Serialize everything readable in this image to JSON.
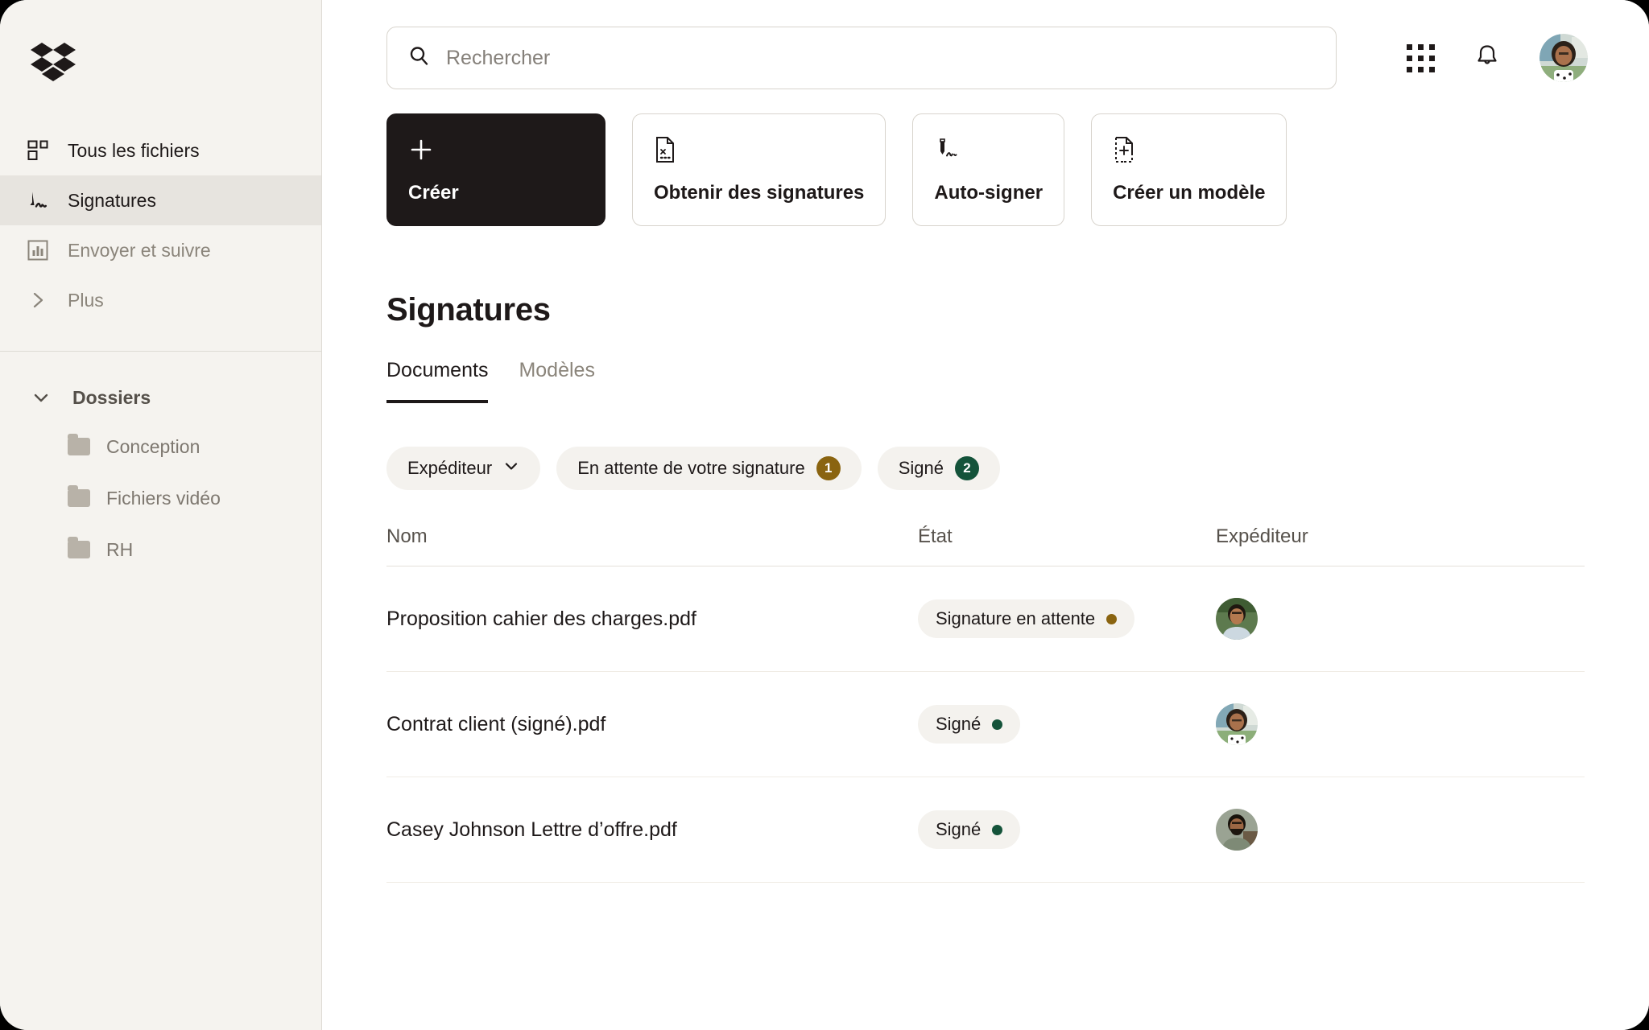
{
  "colors": {
    "sidebar_bg": "#f5f3ef",
    "sidebar_active_bg": "#e7e4df",
    "main_bg": "#ffffff",
    "text_primary": "#1e1919",
    "text_muted": "#8b857b",
    "chip_bg": "#f4f2ee",
    "badge_amber": "#8a6410",
    "badge_green": "#14533a",
    "dot_amber": "#8a6410",
    "dot_green": "#14533a",
    "border": "#d8d4cd"
  },
  "sidebar": {
    "logo_name": "dropbox-logo",
    "items": [
      {
        "label": "Tous les fichiers",
        "icon": "all-files-icon",
        "active": false,
        "strong": true
      },
      {
        "label": "Signatures",
        "icon": "signature-pen-icon",
        "active": true,
        "strong": true
      },
      {
        "label": "Envoyer et suivre",
        "icon": "send-track-chart-icon",
        "active": false,
        "strong": false
      },
      {
        "label": "Plus",
        "icon": "chevron-right-icon",
        "active": false,
        "strong": false
      }
    ],
    "folders_header": {
      "label": "Dossiers",
      "icon": "chevron-down-icon",
      "expanded": true
    },
    "folders": [
      {
        "label": "Conception"
      },
      {
        "label": "Fichiers vidéo"
      },
      {
        "label": "RH"
      }
    ]
  },
  "topbar": {
    "search": {
      "placeholder": "Rechercher",
      "value": "",
      "icon": "search-icon"
    },
    "apps_icon": "grid-apps-icon",
    "notifications_icon": "bell-icon",
    "avatar": "user-avatar"
  },
  "actions": [
    {
      "label": "Créer",
      "icon": "plus-icon",
      "primary": true
    },
    {
      "label": "Obtenir des signatures",
      "icon": "document-signature-request-icon",
      "primary": false
    },
    {
      "label": "Auto-signer",
      "icon": "pen-self-sign-icon",
      "primary": false
    },
    {
      "label": "Créer un modèle",
      "icon": "document-add-template-icon",
      "primary": false
    }
  ],
  "page": {
    "title": "Signatures"
  },
  "tabs": [
    {
      "label": "Documents",
      "active": true
    },
    {
      "label": "Modèles",
      "active": false
    }
  ],
  "filters": [
    {
      "label": "Expéditeur",
      "icon": "chevron-down-icon",
      "badge": null,
      "badge_color": null
    },
    {
      "label": "En attente de votre signature",
      "icon": null,
      "badge": "1",
      "badge_color": "#8a6410"
    },
    {
      "label": "Signé",
      "icon": null,
      "badge": "2",
      "badge_color": "#14533a"
    }
  ],
  "table": {
    "columns": [
      "Nom",
      "État",
      "Expéditeur"
    ],
    "rows": [
      {
        "name": "Proposition cahier des charges.pdf",
        "state": "Signature en attente",
        "state_dot": "#8a6410",
        "sender_avatar": "avatar-man-green"
      },
      {
        "name": "Contrat client (signé).pdf",
        "state": "Signé",
        "state_dot": "#14533a",
        "sender_avatar": "avatar-woman-glasses"
      },
      {
        "name": "Casey Johnson Lettre d’offre.pdf",
        "state": "Signé",
        "state_dot": "#14533a",
        "sender_avatar": "avatar-man-beard"
      }
    ]
  }
}
